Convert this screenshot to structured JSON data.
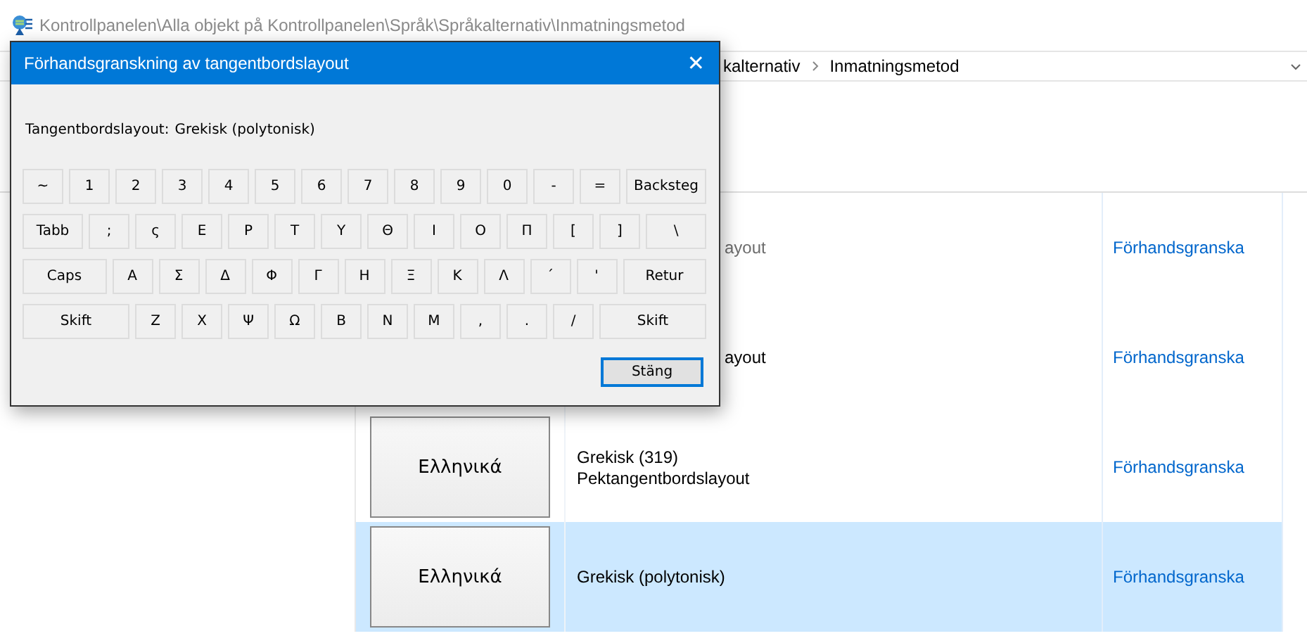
{
  "window": {
    "path": "Kontrollpanelen\\Alla objekt på Kontrollpanelen\\Språk\\Språkalternativ\\Inmatningsmetod"
  },
  "breadcrumb": [
    "kalternativ",
    "Inmatningsmetod"
  ],
  "layouts": [
    {
      "lines": [
        "ayout"
      ],
      "disabled": true,
      "selected": false,
      "action": "Förhandsgranska"
    },
    {
      "lines": [
        "ayout"
      ],
      "disabled": false,
      "selected": false,
      "action": "Förhandsgranska"
    },
    {
      "tile": "Ελληνικά",
      "lines": [
        "Grekisk (319)",
        "Pektangentbordslayout"
      ],
      "disabled": false,
      "selected": false,
      "action": "Förhandsgranska"
    },
    {
      "tile": "Ελληνικά",
      "lines": [
        "Grekisk (polytonisk)"
      ],
      "disabled": false,
      "selected": true,
      "action": "Förhandsgranska"
    }
  ],
  "dialog": {
    "title": "Förhandsgranskning av tangentbordslayout",
    "close": "✕",
    "layout_label": "Tangentbordslayout:",
    "layout_value": "Grekisk (polytonisk)",
    "keyboard": [
      [
        {
          "label": "~",
          "kind": "normal"
        },
        {
          "label": "1",
          "kind": "normal"
        },
        {
          "label": "2",
          "kind": "normal"
        },
        {
          "label": "3",
          "kind": "normal"
        },
        {
          "label": "4",
          "kind": "normal"
        },
        {
          "label": "5",
          "kind": "normal"
        },
        {
          "label": "6",
          "kind": "normal"
        },
        {
          "label": "7",
          "kind": "normal"
        },
        {
          "label": "8",
          "kind": "normal"
        },
        {
          "label": "9",
          "kind": "normal"
        },
        {
          "label": "0",
          "kind": "normal"
        },
        {
          "label": "-",
          "kind": "normal"
        },
        {
          "label": "=",
          "kind": "normal"
        },
        {
          "label": "Backsteg",
          "kind": "wide"
        }
      ],
      [
        {
          "label": "Tabb",
          "kind": "wide"
        },
        {
          "label": ";",
          "kind": "normal"
        },
        {
          "label": "ς",
          "kind": "normal"
        },
        {
          "label": "Ε",
          "kind": "normal"
        },
        {
          "label": "Ρ",
          "kind": "normal"
        },
        {
          "label": "Τ",
          "kind": "normal"
        },
        {
          "label": "Υ",
          "kind": "normal"
        },
        {
          "label": "Θ",
          "kind": "normal"
        },
        {
          "label": "Ι",
          "kind": "normal"
        },
        {
          "label": "Ο",
          "kind": "normal"
        },
        {
          "label": "Π",
          "kind": "normal"
        },
        {
          "label": "[",
          "kind": "normal"
        },
        {
          "label": "]",
          "kind": "normal"
        },
        {
          "label": "\\",
          "kind": "wide"
        }
      ],
      [
        {
          "label": "Caps",
          "kind": "wide"
        },
        {
          "label": "Α",
          "kind": "normal"
        },
        {
          "label": "Σ",
          "kind": "normal"
        },
        {
          "label": "Δ",
          "kind": "normal"
        },
        {
          "label": "Φ",
          "kind": "normal"
        },
        {
          "label": "Γ",
          "kind": "normal"
        },
        {
          "label": "Η",
          "kind": "normal"
        },
        {
          "label": "Ξ",
          "kind": "normal"
        },
        {
          "label": "Κ",
          "kind": "normal"
        },
        {
          "label": "Λ",
          "kind": "normal"
        },
        {
          "label": "΄",
          "kind": "normal"
        },
        {
          "label": "'",
          "kind": "normal"
        },
        {
          "label": "Retur",
          "kind": "wide"
        }
      ],
      [
        {
          "label": "Skift",
          "kind": "wide"
        },
        {
          "label": "Ζ",
          "kind": "normal"
        },
        {
          "label": "Χ",
          "kind": "normal"
        },
        {
          "label": "Ψ",
          "kind": "normal"
        },
        {
          "label": "Ω",
          "kind": "normal"
        },
        {
          "label": "Β",
          "kind": "normal"
        },
        {
          "label": "Ν",
          "kind": "normal"
        },
        {
          "label": "Μ",
          "kind": "normal"
        },
        {
          "label": ",",
          "kind": "normal"
        },
        {
          "label": ".",
          "kind": "normal"
        },
        {
          "label": "/",
          "kind": "normal"
        },
        {
          "label": "Skift",
          "kind": "wide"
        }
      ]
    ],
    "button": "Stäng"
  }
}
